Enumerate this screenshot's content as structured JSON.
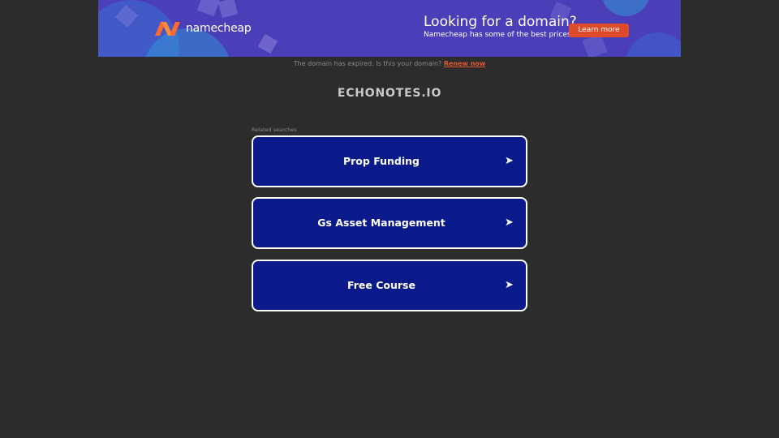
{
  "banner": {
    "brand": "namecheap",
    "title": "Looking for a domain?",
    "subtitle": "Namecheap has some of the best prices.",
    "button_label": "Learn more",
    "accent_color": "#de4a2a",
    "logo_icon": "namecheap-logo-icon"
  },
  "expired_notice": {
    "text": "The domain has expired. Is this your domain?",
    "link_label": "Renew now"
  },
  "domain_name": "ECHONOTES.IO",
  "related": {
    "heading": "Related searches",
    "items": [
      {
        "label": "Prop Funding",
        "icon": "arrow-right-icon",
        "arrow": "➤"
      },
      {
        "label": "Gs Asset Management",
        "icon": "arrow-right-icon",
        "arrow": "➤"
      },
      {
        "label": "Free Course",
        "icon": "arrow-right-icon",
        "arrow": "➤"
      }
    ]
  },
  "colors": {
    "page_background": "#2c2c2c",
    "banner_background": "#4a3fb8",
    "card_background": "#0a1a8a",
    "card_border": "#ffffff"
  }
}
